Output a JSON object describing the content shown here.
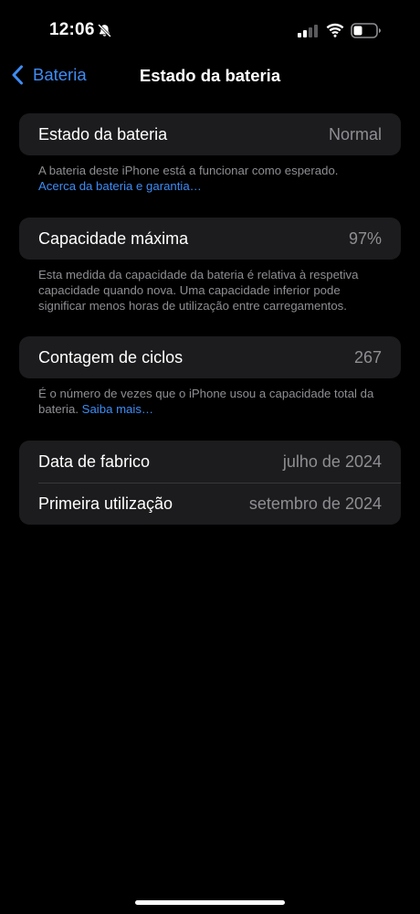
{
  "status_bar": {
    "time": "12:06",
    "silent_icon": "bell-slash-icon",
    "signal_icon": "cellular-signal-icon",
    "wifi_icon": "wifi-icon",
    "battery_icon": "battery-icon"
  },
  "nav": {
    "back_label": "Bateria",
    "title": "Estado da bateria"
  },
  "sections": {
    "health": {
      "label": "Estado da bateria",
      "value": "Normal",
      "footnote": "A bateria deste iPhone está a funcionar como esperado.",
      "link": "Acerca da bateria e garantia…"
    },
    "capacity": {
      "label": "Capacidade máxima",
      "value": "97%",
      "footnote": "Esta medida da capacidade da bateria é relativa à respetiva capacidade quando nova. Uma capacidade inferior pode significar menos horas de utilização entre carregamentos."
    },
    "cycles": {
      "label": "Contagem de ciclos",
      "value": "267",
      "footnote": "É o número de vezes que o iPhone usou a capacidade total da bateria.",
      "link": "Saiba mais…"
    },
    "dates": {
      "manufacture_label": "Data de fabrico",
      "manufacture_value": "julho de 2024",
      "first_use_label": "Primeira utilização",
      "first_use_value": "setembro de 2024"
    }
  },
  "colors": {
    "background": "#000000",
    "card": "#1c1c1e",
    "accent": "#3e8cf5",
    "secondary_text": "#8e8e93"
  }
}
